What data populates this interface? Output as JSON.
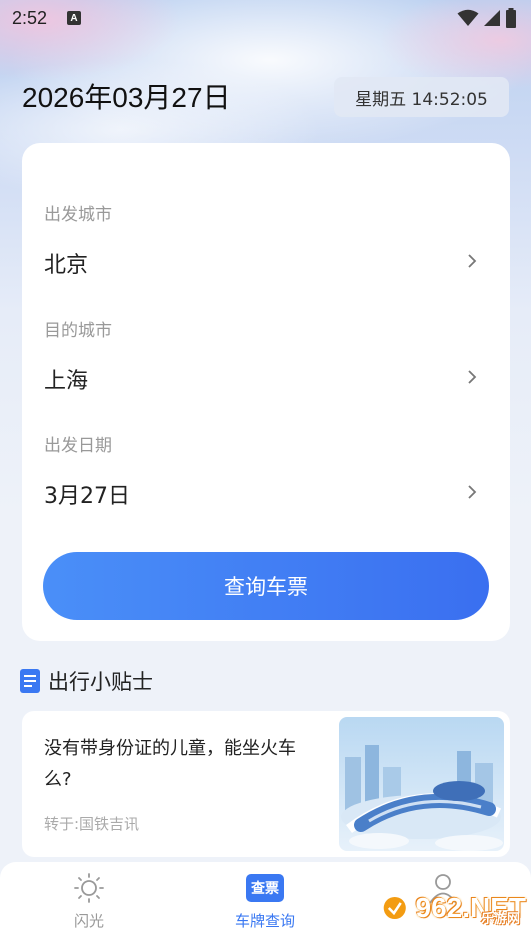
{
  "status_bar": {
    "time": "2:52",
    "notification_letter": "A"
  },
  "header": {
    "date": "2026年03月27日",
    "weekday_time": "星期五 14:52:05"
  },
  "search_form": {
    "departure": {
      "label": "出发城市",
      "value": "北京"
    },
    "destination": {
      "label": "目的城市",
      "value": "上海"
    },
    "date": {
      "label": "出发日期",
      "value": "3月27日"
    },
    "submit_label": "查询车票"
  },
  "tips": {
    "title": "出行小贴士",
    "items": [
      {
        "title": "没有带身份证的儿童，能坐火车么?",
        "source": "转于:国铁吉讯"
      }
    ]
  },
  "tabbar": {
    "items": [
      {
        "label": "闪光",
        "active": false,
        "icon": "sun-icon"
      },
      {
        "label": "车牌查询",
        "active": true,
        "icon": "ticket-query-icon",
        "badge": "查票"
      },
      {
        "label": "",
        "active": false,
        "icon": "user-icon"
      }
    ]
  },
  "watermark": {
    "text": "962.NET",
    "sub": "乐游网"
  },
  "colors": {
    "accent": "#3a78f2",
    "inactive_tab": "#999999",
    "card_bg": "#ffffff"
  }
}
